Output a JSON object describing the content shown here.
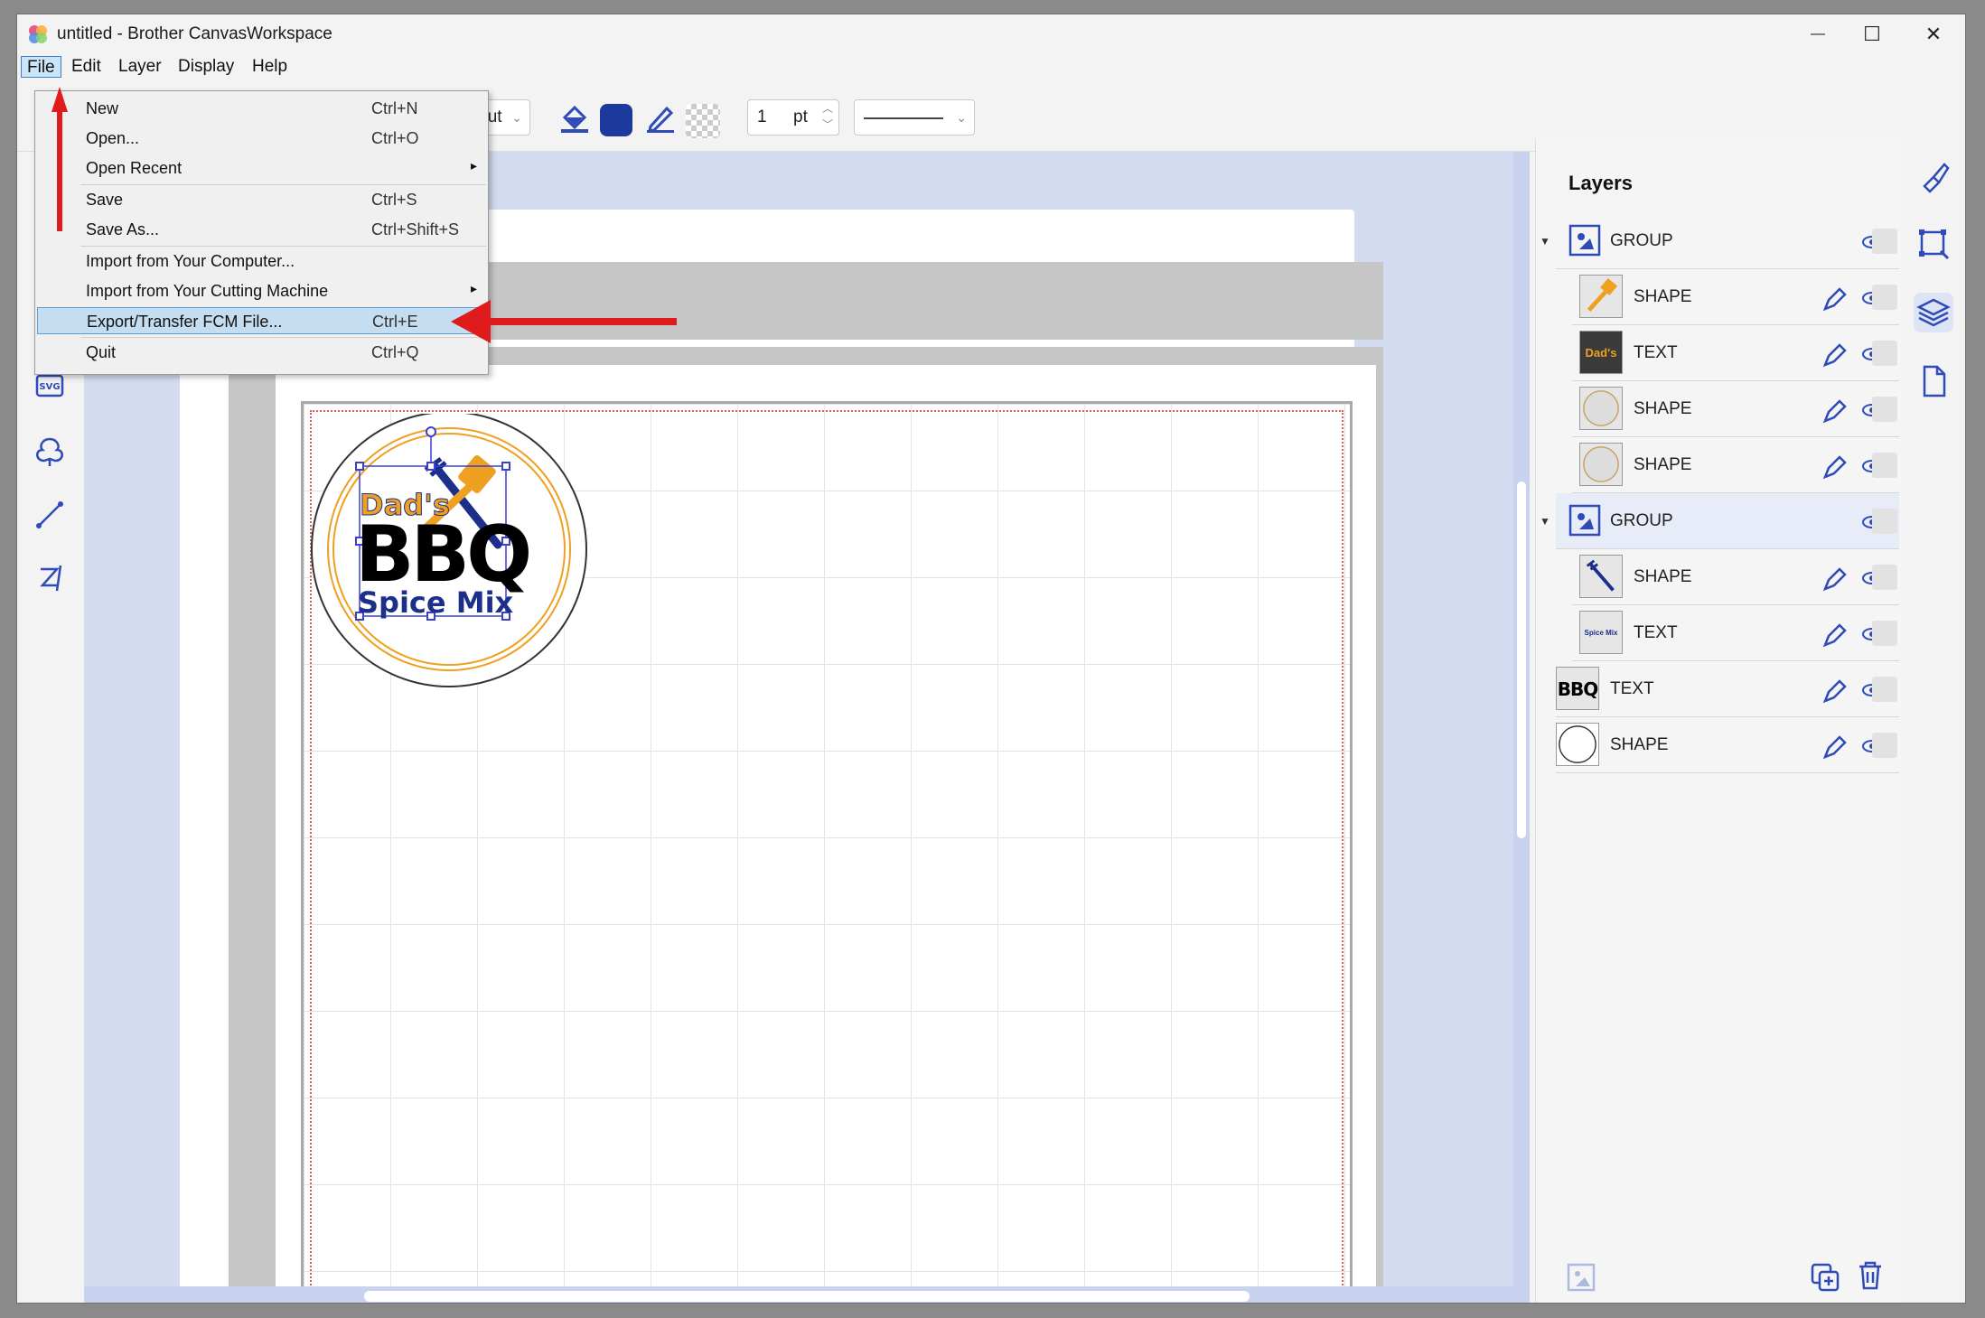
{
  "window": {
    "title": "untitled - Brother CanvasWorkspace"
  },
  "window_controls": {
    "minimize": "—",
    "maximize": "☐",
    "close": "✕"
  },
  "menubar": {
    "items": [
      "File",
      "Edit",
      "Layer",
      "Display",
      "Help"
    ],
    "active": "File"
  },
  "toolbar": {
    "mode_value": "Cut",
    "fill_color": "#1c3a9e",
    "line_width": "1",
    "line_unit": "pt"
  },
  "file_menu": {
    "items": [
      {
        "label": "New",
        "shortcut": "Ctrl+N"
      },
      {
        "label": "Open...",
        "shortcut": "Ctrl+O"
      },
      {
        "label": "Open Recent",
        "shortcut": "",
        "submenu": "▸"
      },
      {
        "label": "Save",
        "shortcut": "Ctrl+S"
      },
      {
        "label": "Save As...",
        "shortcut": "Ctrl+Shift+S"
      },
      {
        "label": "Import from Your Computer...",
        "shortcut": ""
      },
      {
        "label": "Import from Your Cutting Machine",
        "shortcut": "",
        "submenu": "▸"
      },
      {
        "label": "Export/Transfer FCM File...",
        "shortcut": "Ctrl+E",
        "highlighted": true
      },
      {
        "label": "Quit",
        "shortcut": "Ctrl+Q"
      }
    ]
  },
  "design": {
    "line1": "Dad's",
    "line2": "BBQ",
    "line3": "Spice Mix"
  },
  "layers_panel": {
    "title": "Layers",
    "rows": [
      {
        "label": "GROUP",
        "thumb": "group-icon"
      },
      {
        "label": "SHAPE",
        "thumb": "spatula"
      },
      {
        "label": "TEXT",
        "thumb": "Dad's"
      },
      {
        "label": "SHAPE",
        "thumb": "circle"
      },
      {
        "label": "SHAPE",
        "thumb": "circle"
      },
      {
        "label": "GROUP",
        "thumb": "group-icon"
      },
      {
        "label": "SHAPE",
        "thumb": "fork"
      },
      {
        "label": "TEXT",
        "thumb": "Spice Mix"
      },
      {
        "label": "TEXT",
        "thumb": "BBQ"
      },
      {
        "label": "SHAPE",
        "thumb": "circle"
      }
    ]
  },
  "colors": {
    "accent": "#3a4fc4",
    "orange": "#f0a020",
    "annotation_red": "#e01b1b"
  }
}
